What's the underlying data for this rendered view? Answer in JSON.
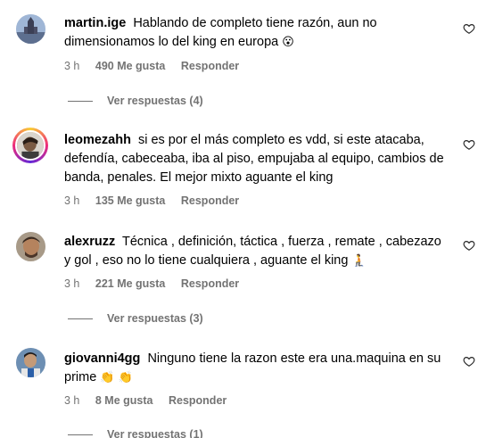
{
  "comments": [
    {
      "username": "martin.ige",
      "text": "Hablando de completo tiene razón, aun no dimensionamos lo del king en europa",
      "emoji": "😮",
      "time": "3 h",
      "likes": "490 Me gusta",
      "reply_label": "Responder",
      "view_replies": "Ver respuestas (4)"
    },
    {
      "username": "leomezahh",
      "text": "si es por el más completo es vdd, si este atacaba, defendía, cabeceaba, iba al piso, empujaba al equipo, cambios de banda, penales. El mejor mixto aguante el king",
      "emoji": "",
      "time": "3 h",
      "likes": "135 Me gusta",
      "reply_label": "Responder",
      "view_replies": ""
    },
    {
      "username": "alexruzz",
      "text": "Técnica , definición, táctica , fuerza , remate , cabezazo y gol , eso no lo tiene cualquiera , aguante el king",
      "emoji": "🧎",
      "time": "3 h",
      "likes": "221 Me gusta",
      "reply_label": "Responder",
      "view_replies": "Ver respuestas (3)"
    },
    {
      "username": "giovanni4gg",
      "text": "Ninguno tiene la razon este era una.maquina en su prime",
      "emoji": "👏 👏",
      "time": "3 h",
      "likes": "8 Me gusta",
      "reply_label": "Responder",
      "view_replies": "Ver respuestas (1)"
    }
  ]
}
